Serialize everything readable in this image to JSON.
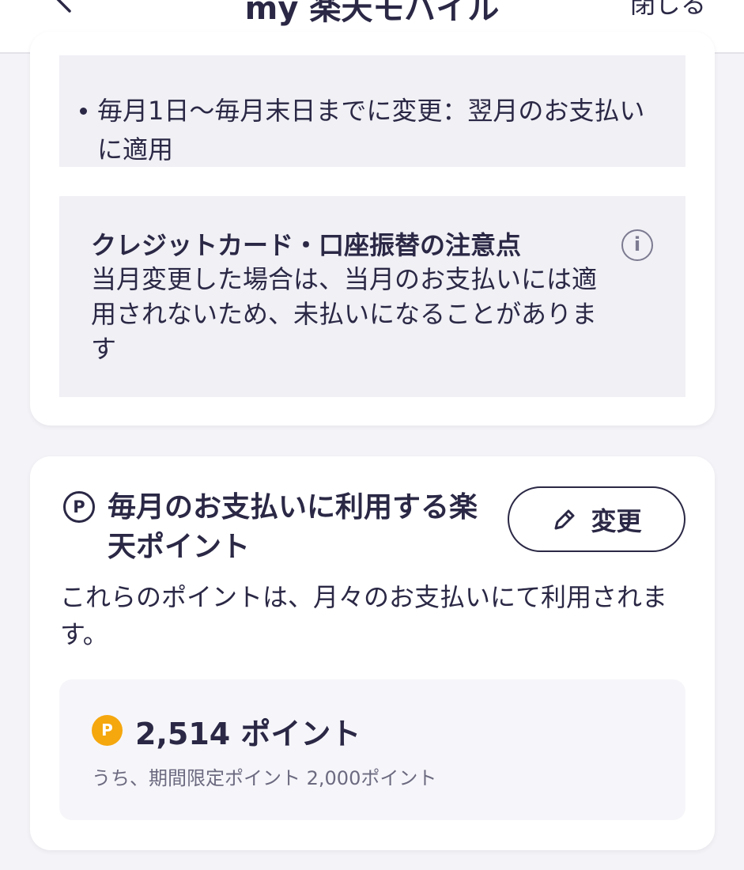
{
  "header": {
    "title": "my 楽天モバイル",
    "close_label": "閉じる",
    "back_icon": "chevron-left-icon"
  },
  "payment_timing": {
    "bullet_text": "毎月1日～毎月末日までに変更：翌月のお支払いに適用"
  },
  "caution": {
    "title": "クレジットカード・口座振替の注意点",
    "body": "当月変更した場合は、当月のお支払いには適用されないため、未払いになることがあります",
    "icon": "info-icon"
  },
  "points_section": {
    "title": "毎月のお支払いに利用する楽天ポイント",
    "edit_label": "変更",
    "description": "これらのポイントは、月々のお支払いにて利用されます。",
    "points_value": "2,514 ポイント",
    "points_sub": "うち、期間限定ポイント 2,000ポイント",
    "p_symbol": "P",
    "coin_color": "#f5a70e"
  },
  "colors": {
    "text": "#2a2845",
    "background": "#f4f4f8",
    "box": "#f0f0f5"
  }
}
